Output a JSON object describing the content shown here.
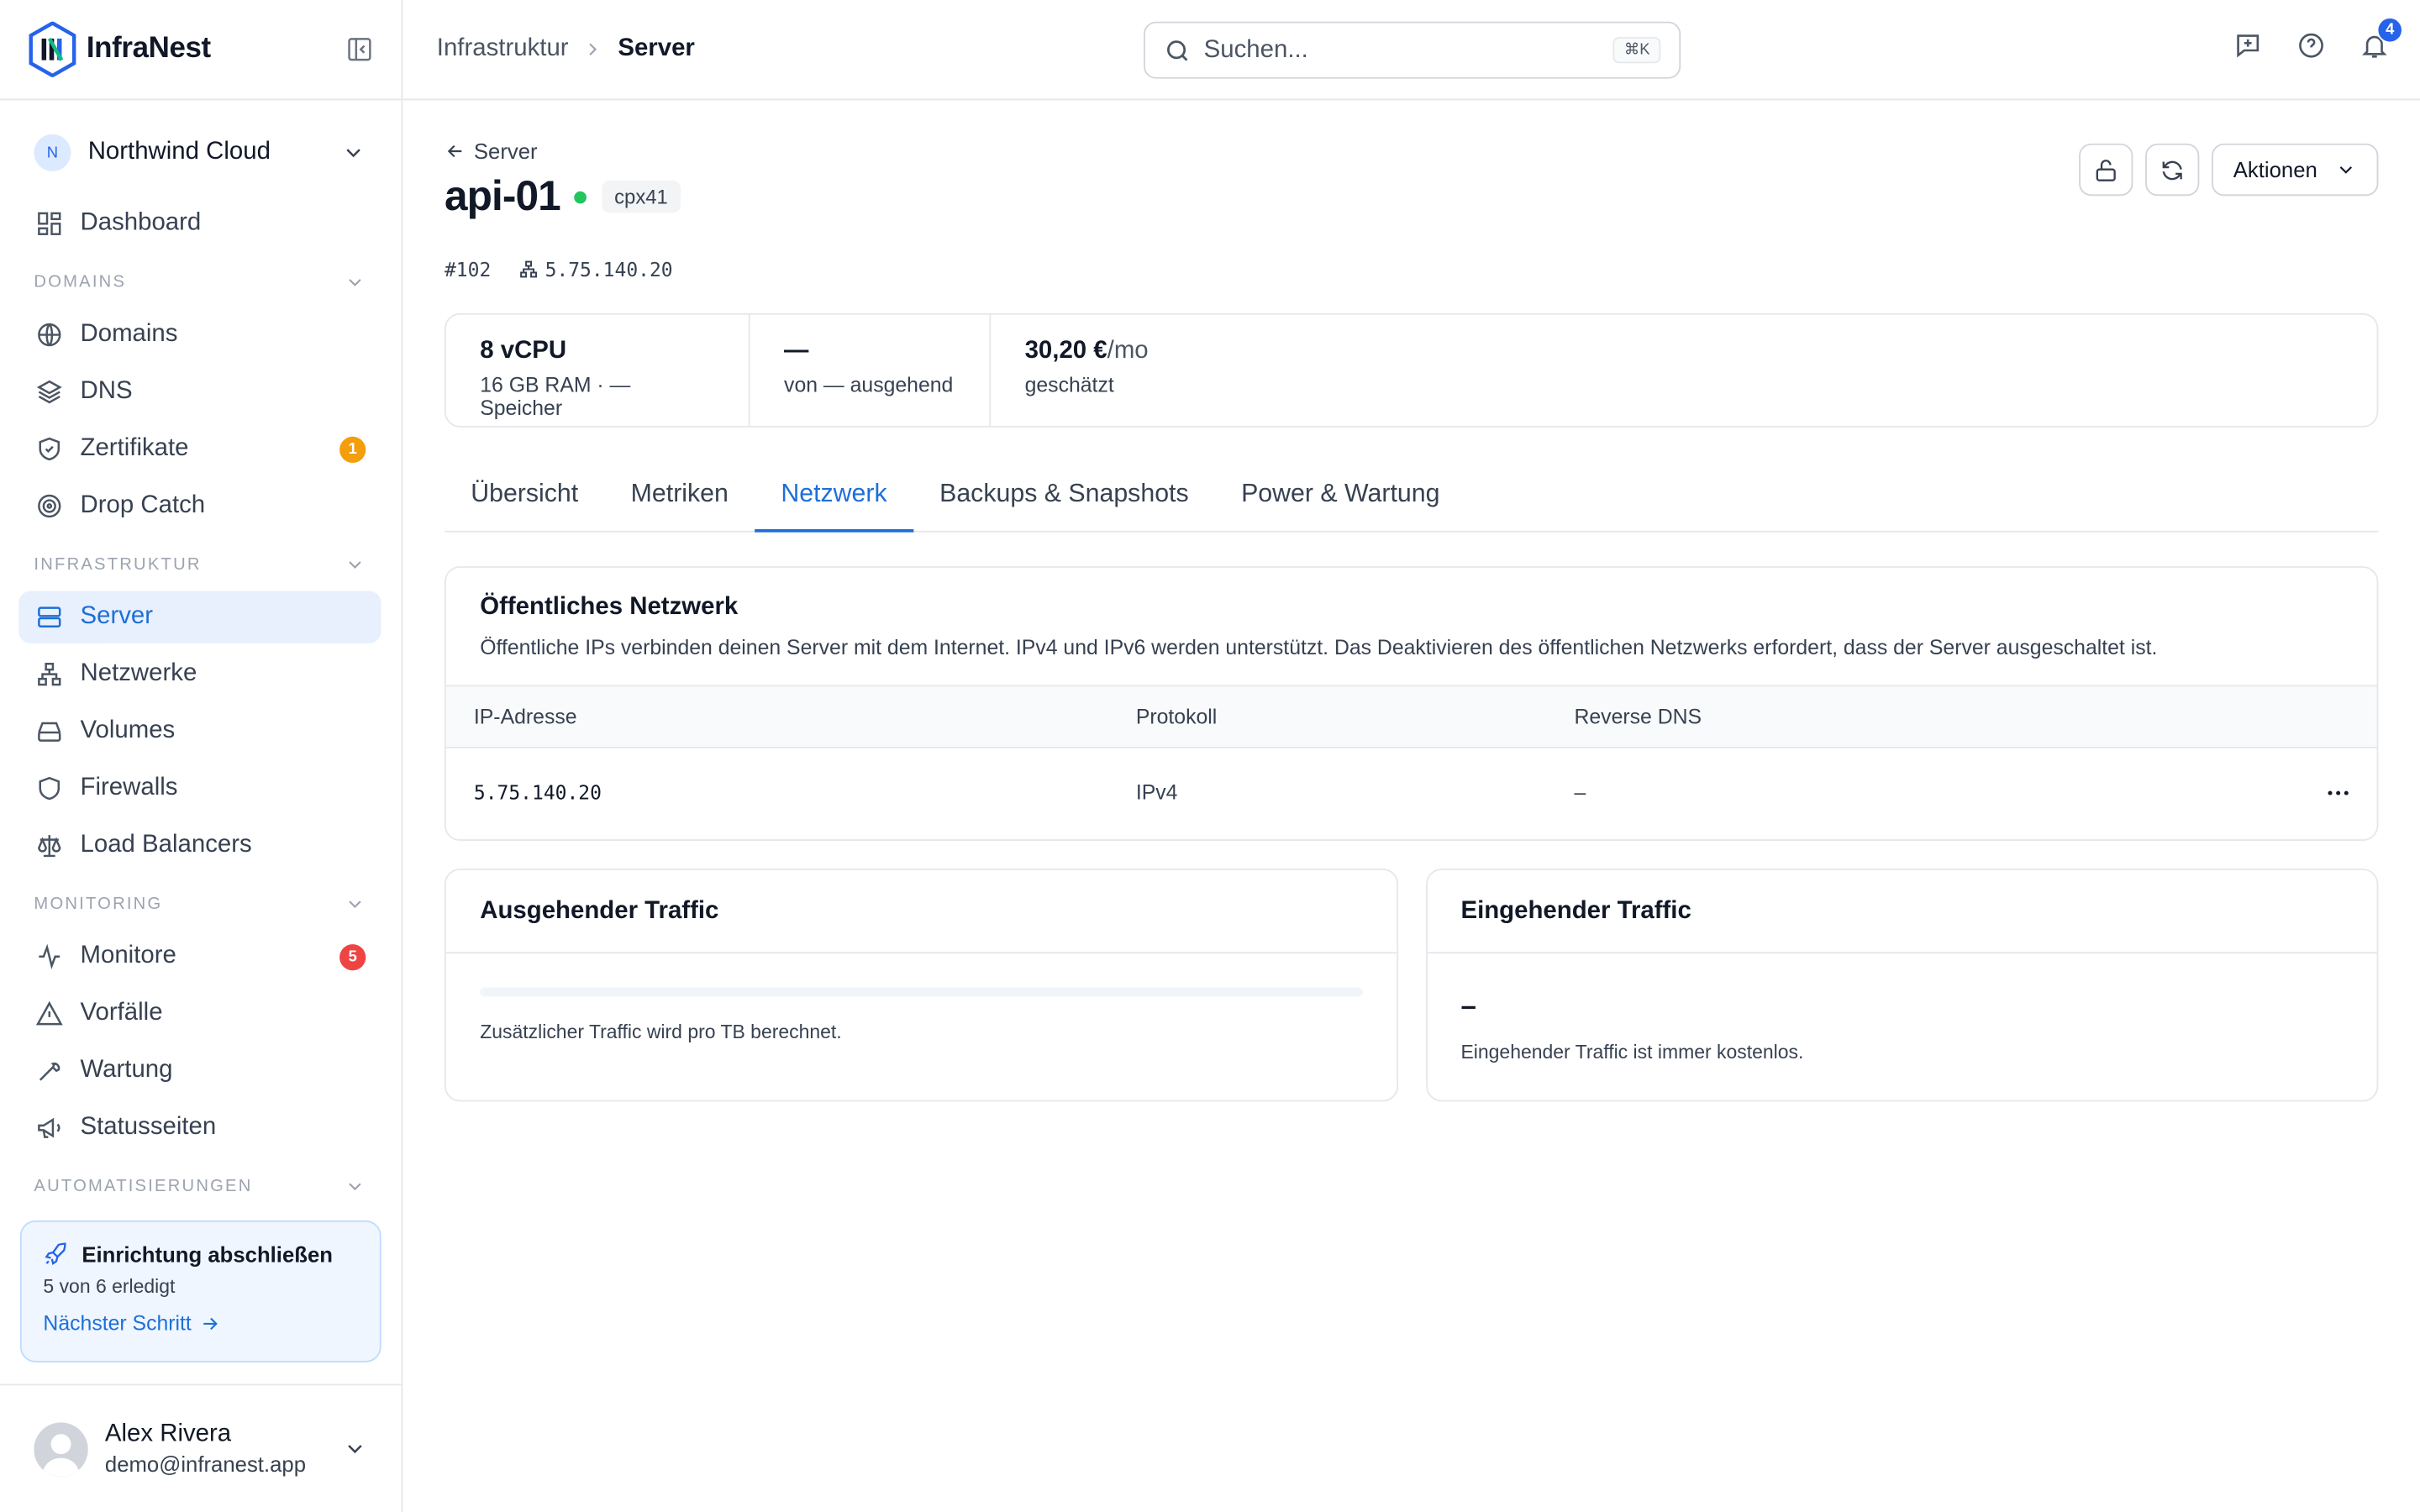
{
  "brand": {
    "name": "InfraNest"
  },
  "org": {
    "initial": "N",
    "name": "Northwind Cloud"
  },
  "nav": {
    "dashboard": "Dashboard",
    "sections": {
      "domains": "DOMAINS",
      "infra": "INFRASTRUKTUR",
      "monitoring": "MONITORING",
      "automation": "AUTOMATISIERUNGEN"
    },
    "domains": "Domains",
    "dns": "DNS",
    "certs": "Zertifikate",
    "certs_badge": "1",
    "dropcatch": "Drop Catch",
    "server": "Server",
    "networks": "Netzwerke",
    "volumes": "Volumes",
    "firewalls": "Firewalls",
    "lb": "Load Balancers",
    "monitors": "Monitore",
    "monitors_badge": "5",
    "incidents": "Vorfälle",
    "maintenance": "Wartung",
    "statuspages": "Statusseiten"
  },
  "colors": {
    "accent": "#1d6fd8",
    "badge_warn": "#f59e0b",
    "badge_err": "#ef4444",
    "status_online": "#22c55e"
  },
  "setup": {
    "title": "Einrichtung abschließen",
    "progress": "5 von 6 erledigt",
    "next": "Nächster Schritt"
  },
  "user": {
    "name": "Alex Rivera",
    "email": "demo@infranest.app"
  },
  "topbar": {
    "crumb1": "Infrastruktur",
    "crumb2": "Server",
    "search_placeholder": "Suchen...",
    "shortcut": "⌘K",
    "notifications": "4"
  },
  "server": {
    "back": "Server",
    "name": "api-01",
    "plan": "cpx41",
    "id": "#102",
    "ip": "5.75.140.20",
    "actions": "Aktionen"
  },
  "stats": [
    {
      "value": "8 vCPU",
      "unit": "",
      "label": "16 GB RAM · — Speicher"
    },
    {
      "value": "—",
      "unit": "",
      "label": "von — ausgehend"
    },
    {
      "value": "30,20 €",
      "unit": "/mo",
      "label": "geschätzt"
    }
  ],
  "tabs": [
    "Übersicht",
    "Metriken",
    "Netzwerk",
    "Backups & Snapshots",
    "Power & Wartung"
  ],
  "network": {
    "title": "Öffentliches Netzwerk",
    "desc": "Öffentliche IPs verbinden deinen Server mit dem Internet. IPv4 und IPv6 werden unterstützt. Das Deaktivieren des öffentlichen Netzwerks erfordert, dass der Server ausgeschaltet ist.",
    "columns": [
      "IP-Adresse",
      "Protokoll",
      "Reverse DNS"
    ],
    "rows": [
      {
        "ip": "5.75.140.20",
        "protocol": "IPv4",
        "rdns": "–"
      }
    ]
  },
  "outgoing": {
    "title": "Ausgehender Traffic",
    "progress": 0,
    "note": "Zusätzlicher Traffic wird pro TB berechnet."
  },
  "incoming": {
    "title": "Eingehender Traffic",
    "value": "–",
    "note": "Eingehender Traffic ist immer kostenlos."
  }
}
